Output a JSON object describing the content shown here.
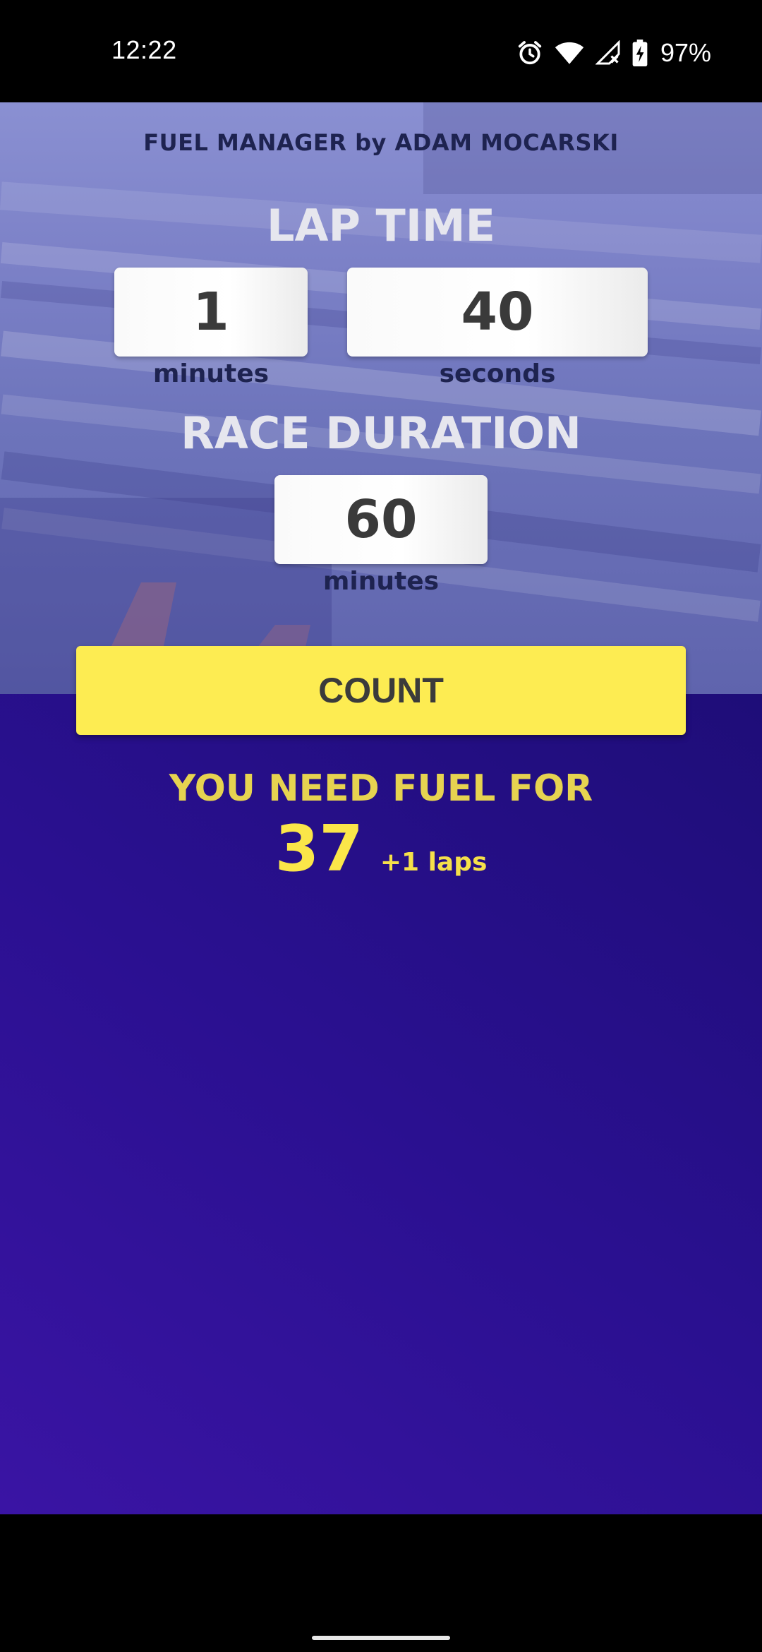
{
  "status_bar": {
    "time": "12:22",
    "battery_percent": "97%",
    "icons": [
      "alarm-icon",
      "wifi-icon",
      "signal-no-service-icon",
      "battery-charging-icon"
    ]
  },
  "app": {
    "title": "FUEL MANAGER by ADAM MOCARSKI",
    "lap_time": {
      "label": "LAP TIME",
      "minutes_value": "1",
      "minutes_unit": "minutes",
      "seconds_value": "40",
      "seconds_unit": "seconds"
    },
    "race_duration": {
      "label": "RACE DURATION",
      "minutes_value": "60",
      "minutes_unit": "minutes"
    },
    "count_button": "COUNT",
    "result": {
      "heading": "YOU NEED FUEL FOR",
      "laps": "37",
      "extra": "+1 laps"
    }
  },
  "colors": {
    "accent_yellow": "#fdec52",
    "result_yellow": "#fbe649",
    "background_purple": "#2a1090",
    "label_navy": "#1e2350"
  }
}
